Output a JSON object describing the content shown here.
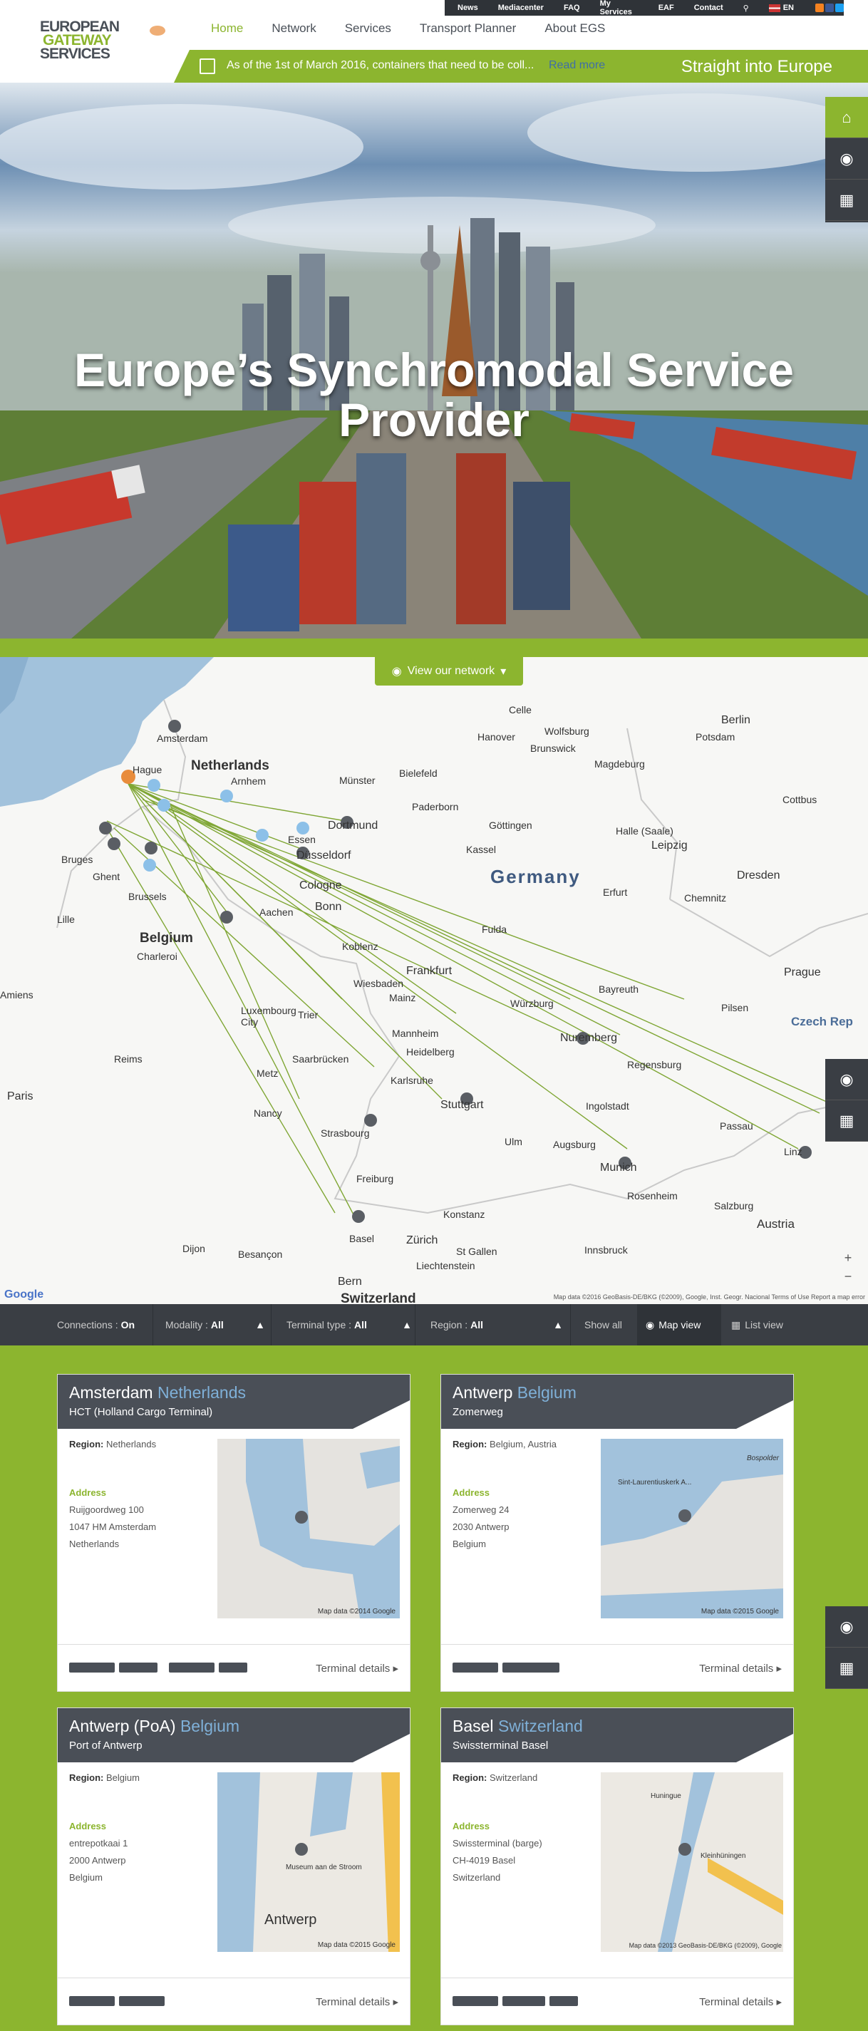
{
  "brand": {
    "line1": "EUROPEAN",
    "line2": "GATEWAY",
    "line3": "SERVICES"
  },
  "topbar": {
    "items": [
      "News",
      "Mediacenter",
      "FAQ",
      "My Services",
      "EAF",
      "Contact"
    ],
    "lang": "EN"
  },
  "nav": {
    "items": [
      "Home",
      "Network",
      "Services",
      "Transport Planner",
      "About EGS"
    ],
    "active": "Home"
  },
  "news": {
    "text": "As of the 1st of March 2016, containers that need to be coll...",
    "more": "Read more",
    "tagline": "Straight into Europe"
  },
  "hero": {
    "title_line1": "Europe’s Synchromodal Service",
    "title_line2": "Provider"
  },
  "map": {
    "button": "View our network",
    "country": "Germany",
    "labels": {
      "netherlands": "Netherlands",
      "belgium": "Belgium",
      "switzerland": "Switzerland",
      "czech": "Czech Rep",
      "austria": "Austria",
      "liechtenstein": "Liechtenstein",
      "amsterdam": "Amsterdam",
      "hague": "Hague",
      "arnhem": "Arnhem",
      "brussels": "Brussels",
      "ghent": "Ghent",
      "bruges": "Bruges",
      "lille": "Lille",
      "charleroi": "Charleroi",
      "paris": "Paris",
      "reims": "Reims",
      "amiens": "Amiens",
      "metz": "Metz",
      "nancy": "Nancy",
      "strasbourg": "Strasbourg",
      "dijon": "Dijon",
      "besancon": "Besançon",
      "bern": "Bern",
      "zurich": "Zürich",
      "basel": "Basel",
      "stgallen": "St Gallen",
      "munster": "Münster",
      "bielefeld": "Bielefeld",
      "hanover": "Hanover",
      "berlin": "Berlin",
      "potsdam": "Potsdam",
      "leipzig": "Leipzig",
      "dresden": "Dresden",
      "dortmund": "Dortmund",
      "essen": "Essen",
      "dusseldorf": "Düsseldorf",
      "cologne": "Cologne",
      "bonn": "Bonn",
      "frankfurt": "Frankfurt",
      "mannheim": "Mannheim",
      "stuttgart": "Stuttgart",
      "nuremberg": "Nuremberg",
      "munich": "Munich",
      "prague": "Prague",
      "kassel": "Kassel",
      "erfurt": "Erfurt",
      "wurzburg": "Würzburg",
      "augsburg": "Augsburg",
      "ulm": "Ulm",
      "linz": "Linz",
      "salzburg": "Salzburg",
      "innsbruck": "Innsbruck",
      "bayreuth": "Bayreuth",
      "pilsen": "Pilsen",
      "passau": "Passau",
      "koblenz": "Koblenz",
      "luxembourg": "Luxembourg City",
      "karlsruhe": "Karlsruhe",
      "freiburg": "Freiburg",
      "aachen": "Aachen",
      "halle": "Halle (Saale)",
      "chemnitz": "Chemnitz",
      "gottingen": "Göttingen",
      "paderborn": "Paderborn",
      "magdeburg": "Magdeburg",
      "wolfsburg": "Wolfsburg",
      "brunswick": "Brunswick",
      "celle": "Celle",
      "fulda": "Fulda",
      "saarbrucken": "Saarbrücken",
      "heidelberg": "Heidelberg",
      "wiesbaden": "Wiesbaden",
      "mainz": "Mainz",
      "trier": "Trier",
      "ingolstadt": "Ingolstadt",
      "regensburg": "Regensburg",
      "rosenheim": "Rosenheim",
      "konstanz": "Konstanz",
      "cottbus": "Cottbus"
    },
    "attribution": "Map data ©2016 GeoBasis-DE/BKG (©2009), Google, Inst. Geogr. Nacional   Terms of Use   Report a map error",
    "google": "Google"
  },
  "filters": {
    "connections_label": "Connections :",
    "connections_value": "On",
    "modality_label": "Modality :",
    "modality_value": "All",
    "terminal_label": "Terminal type :",
    "terminal_value": "All",
    "region_label": "Region :",
    "region_value": "All",
    "show_all": "Show all",
    "map_view": "Map view",
    "list_view": "List view"
  },
  "cards": [
    {
      "city": "Amsterdam",
      "country": "Netherlands",
      "terminal": "HCT (Holland Cargo Terminal)",
      "region_label": "Region:",
      "region": "Netherlands",
      "address_label": "Address",
      "address": [
        "Ruijgoordweg 100",
        "1047 HM Amsterdam",
        "Netherlands"
      ],
      "map_credit": "Map data ©2014 Google",
      "details": "Terminal details"
    },
    {
      "city": "Antwerp",
      "country": "Belgium",
      "terminal": "Zomerweg",
      "region_label": "Region:",
      "region": "Belgium, Austria",
      "address_label": "Address",
      "address": [
        "Zomerweg 24",
        "2030 Antwerp",
        "Belgium"
      ],
      "map_credit": "Map data ©2015 Google",
      "map_label": "Sint-Laurentiuskerk A...",
      "map_label2": "Bospolder",
      "details": "Terminal details"
    },
    {
      "city": "Antwerp (PoA)",
      "country": "Belgium",
      "terminal": "Port of Antwerp",
      "region_label": "Region:",
      "region": "Belgium",
      "address_label": "Address",
      "address": [
        "entrepotkaai 1",
        "2000 Antwerp",
        "Belgium"
      ],
      "map_credit": "Map data ©2015 Google",
      "map_label": "Museum aan de Stroom",
      "map_label2": "Antwerp",
      "details": "Terminal details"
    },
    {
      "city": "Basel",
      "country": "Switzerland",
      "terminal": "Swissterminal Basel",
      "region_label": "Region:",
      "region": "Switzerland",
      "address_label": "Address",
      "address": [
        "Swissterminal (barge)",
        "CH-4019 Basel",
        "Switzerland"
      ],
      "map_credit": "Map data ©2013 GeoBasis-DE/BKG (©2009), Google",
      "map_label": "Kleinhüningen",
      "map_label2": "Huningue",
      "details": "Terminal details"
    }
  ],
  "colors": {
    "green": "#8cb52f",
    "dark": "#3a3e44",
    "blue": "#7fb0d8"
  }
}
